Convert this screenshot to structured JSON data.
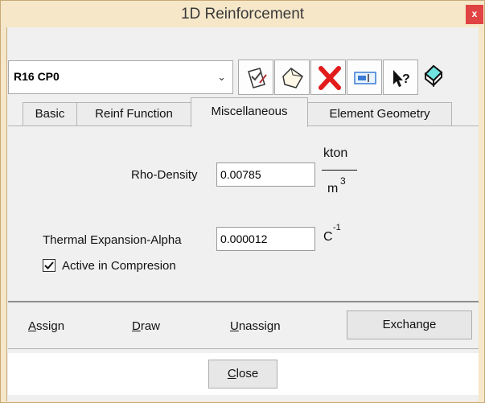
{
  "window": {
    "title": "1D Reinforcement",
    "close_glyph": "x"
  },
  "toolbar": {
    "combo_value": "R16 CP0",
    "combo_arrow": "⌄",
    "buttons": [
      {
        "icon": "modify-icon"
      },
      {
        "icon": "new-icon"
      },
      {
        "icon": "delete-icon"
      },
      {
        "icon": "rename-icon"
      },
      {
        "icon": "help-pointer-icon"
      },
      {
        "icon": "eraser-icon"
      }
    ]
  },
  "tabs": [
    {
      "label": "Basic",
      "active": false
    },
    {
      "label": "Reinf Function",
      "active": false
    },
    {
      "label": "Miscellaneous",
      "active": true
    },
    {
      "label": "Element Geometry",
      "active": false
    }
  ],
  "misc": {
    "density_label": "Rho-Density",
    "density_value": "0.00785",
    "density_unit_num": "kton",
    "density_unit_den": "m",
    "density_unit_exp": "3",
    "alpha_label": "Thermal Expansion-Alpha",
    "alpha_value": "0.000012",
    "alpha_unit": "C",
    "alpha_unit_exp": "-1",
    "compression_label": "Active in Compresion",
    "compression_checked": true
  },
  "actions": {
    "assign_first": "A",
    "assign_rest": "ssign",
    "draw_first": "D",
    "draw_rest": "raw",
    "unassign_first": "U",
    "unassign_rest": "nassign",
    "exchange": "Exchange"
  },
  "footer": {
    "close_first": "C",
    "close_rest": "lose"
  },
  "colors": {
    "frame": "#f6e7c9",
    "close_red": "#e04343",
    "delete_red": "#e21b1b",
    "client": "#f0f0f0"
  }
}
